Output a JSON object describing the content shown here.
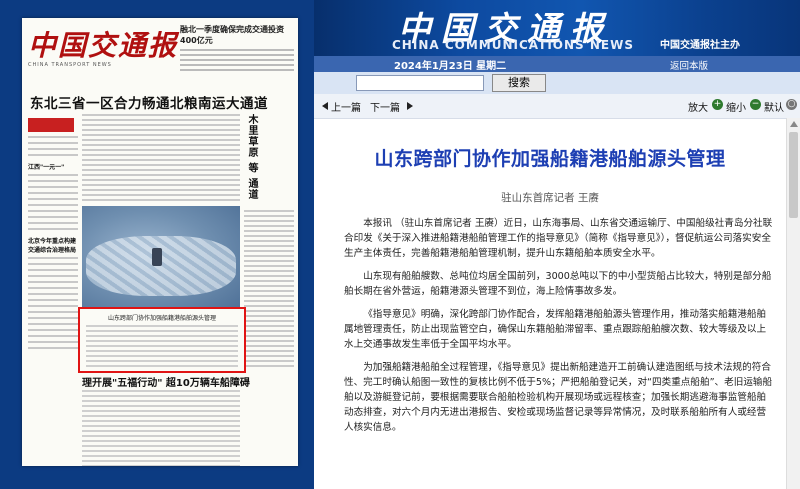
{
  "header": {
    "title_cn": "中国交通报",
    "title_en": "CHINA COMMUNICATIONS NEWS",
    "sponsor": "中国交通报社主办",
    "date": "2024年1月23日 星期二",
    "home_link": "返回本版",
    "search_button": "搜索",
    "search_value": ""
  },
  "newspaper": {
    "logo": "中国交通报",
    "logo_en": "CHINA TRANSPORT NEWS",
    "top_news": "融北一季度确保完成交通投资400亿元",
    "headline": "东北三省一区合力畅通北粮南运大通道",
    "side_heads": [
      "江西\"一元一\"",
      "北京今年重点构建交通综合治理格局"
    ],
    "right_vertical": "木里草原 等 通道",
    "highlight_title": "山东跨部门协作加强船籍港船舶源头管理",
    "bottom_head": "理开展\"五福行动\" 超10万辆车船障碍"
  },
  "nav": {
    "prev": "上一篇",
    "next": "下一篇",
    "zoom_in": "放大",
    "zoom_out": "缩小",
    "default": "默认"
  },
  "article": {
    "title": "山东跨部门协作加强船籍港船舶源头管理",
    "byline": "驻山东首席记者  王赓",
    "paragraphs": [
      "本报讯 （驻山东首席记者 王赓）近日，山东海事局、山东省交通运输厅、中国船级社青岛分社联合印发《关于深入推进船籍港船舶管理工作的指导意见》（简称《指导意见》），督促航运公司落实安全生产主体责任，完善船籍港船舶管理机制，提升山东籍船舶本质安全水平。",
      "山东现有船舶艘数、总吨位均居全国前列，3000总吨以下的中小型货船占比较大，特别是部分船舶长期在省外营运，船籍港源头管理不到位，海上险情事故多发。",
      "《指导意见》明确，深化跨部门协作配合，发挥船籍港船舶源头管理作用，推动落实船籍港船舶属地管理责任，防止出现监管空白，确保山东籍船舶滞留率、重点跟踪船舶艘次数、较大等级及以上水上交通事故发生率低于全国平均水平。",
      "为加强船籍港船舶全过程管理，《指导意见》提出新船建造开工前确认建造图纸与技术法规的符合性、完工时确认船图一致性的复核比例不低于5%；严把船舶登记关，对“四类重点船舶”、老旧运输船舶以及游艇登记前，要根据需要联合船舶检验机构开展现场或远程核查；加强长期逃避海事监管船舶动态排查，对六个月内无进出港报告、安检或现场监督记录等异常情况，及时联系船舶所有人或经营人核实信息。"
    ]
  }
}
